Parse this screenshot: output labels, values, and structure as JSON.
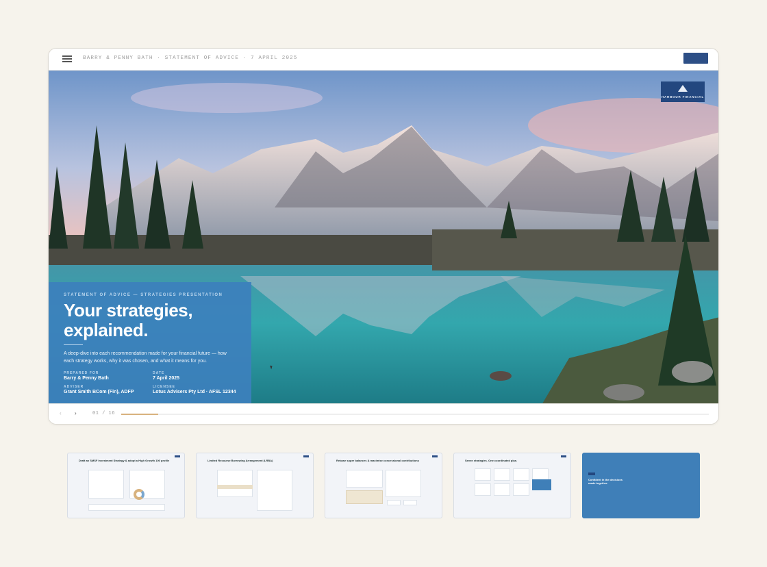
{
  "topbar": {
    "title": "BARRY & PENNY BATH · STATEMENT OF ADVICE · 7 APRIL 2025",
    "logo_icon": "harbour-financial-logo",
    "menu_icon": "hamburger-menu-icon"
  },
  "brand": {
    "name": "HARBOUR FINANCIAL",
    "color": "#23477f"
  },
  "hero": {
    "eyebrow": "STATEMENT OF ADVICE — STRATEGIES PRESENTATION",
    "headline_line1": "Your strategies,",
    "headline_line2": "explained.",
    "subtitle": "A deep-dive into each recommendation made for your financial future — how each strategy works, why it was chosen, and what it means for you.",
    "meta": [
      {
        "label": "PREPARED FOR",
        "value": "Barry & Penny Bath"
      },
      {
        "label": "DATE",
        "value": "7 April 2025"
      },
      {
        "label": "ADVISER",
        "value": "Grant Smith BCom (Fin), ADFP"
      },
      {
        "label": "LICENSEE",
        "value": "Lotus Advisers Pty Ltd · AFSL 12344"
      }
    ],
    "panel_color": "#3c80bc"
  },
  "navigation": {
    "prev_icon": "chevron-left-icon",
    "next_icon": "chevron-right-icon",
    "prev_glyph": "‹",
    "next_glyph": "›",
    "counter": "01 / 16",
    "progress": 0.0625
  },
  "thumbnails": [
    {
      "title": "Draft an SMSF Investment Strategy & adopt a High Growth 100 profile"
    },
    {
      "title": "Limited Recourse Borrowing Arrangement (LRBA)"
    },
    {
      "title": "Rebase super balances & maximise concessional contributions"
    },
    {
      "title": "Seven strategies. One coordinated plan."
    },
    {
      "title": "Confident in the decisions made together."
    }
  ]
}
